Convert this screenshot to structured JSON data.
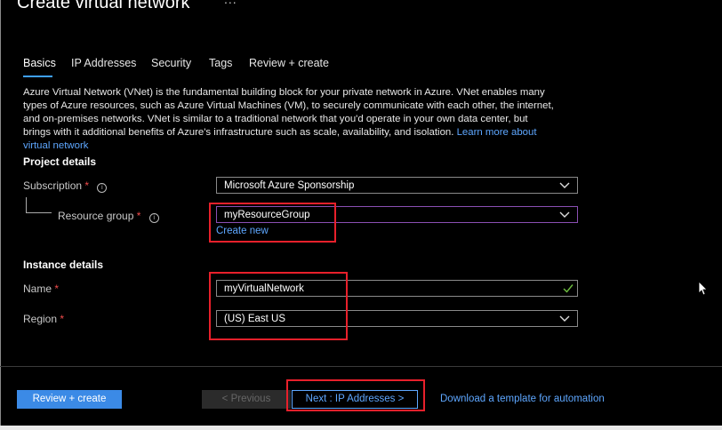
{
  "header": {
    "title": "Create virtual network",
    "more": "..."
  },
  "tabs": [
    {
      "label": "Basics",
      "active": true
    },
    {
      "label": "IP Addresses"
    },
    {
      "label": "Security"
    },
    {
      "label": "Tags"
    },
    {
      "label": "Review + create"
    }
  ],
  "intro": {
    "text": "Azure Virtual Network (VNet) is the fundamental building block for your private network in Azure. VNet enables many types of Azure resources, such as Azure Virtual Machines (VM), to securely communicate with each other, the internet, and on-premises networks. VNet is similar to a traditional network that you'd operate in your own data center, but brings with it additional benefits of Azure's infrastructure such as scale, availability, and isolation.",
    "link": "Learn more about virtual network"
  },
  "project": {
    "heading": "Project details",
    "subscription_label": "Subscription",
    "subscription_value": "Microsoft Azure Sponsorship",
    "rg_label": "Resource group",
    "rg_value": "myResourceGroup",
    "create_new": "Create new",
    "required_mark": "*"
  },
  "instance": {
    "heading": "Instance details",
    "name_label": "Name",
    "name_value": "myVirtualNetwork",
    "region_label": "Region",
    "region_value": "(US) East US"
  },
  "footer": {
    "review_create": "Review + create",
    "previous": "< Previous",
    "next": "Next : IP Addresses >",
    "download": "Download a template for automation"
  },
  "colors": {
    "accent": "#3b8ae6",
    "link": "#5ea7ff",
    "highlight": "#e8202b",
    "required": "#f14c4c",
    "valid": "#6fbf40"
  }
}
